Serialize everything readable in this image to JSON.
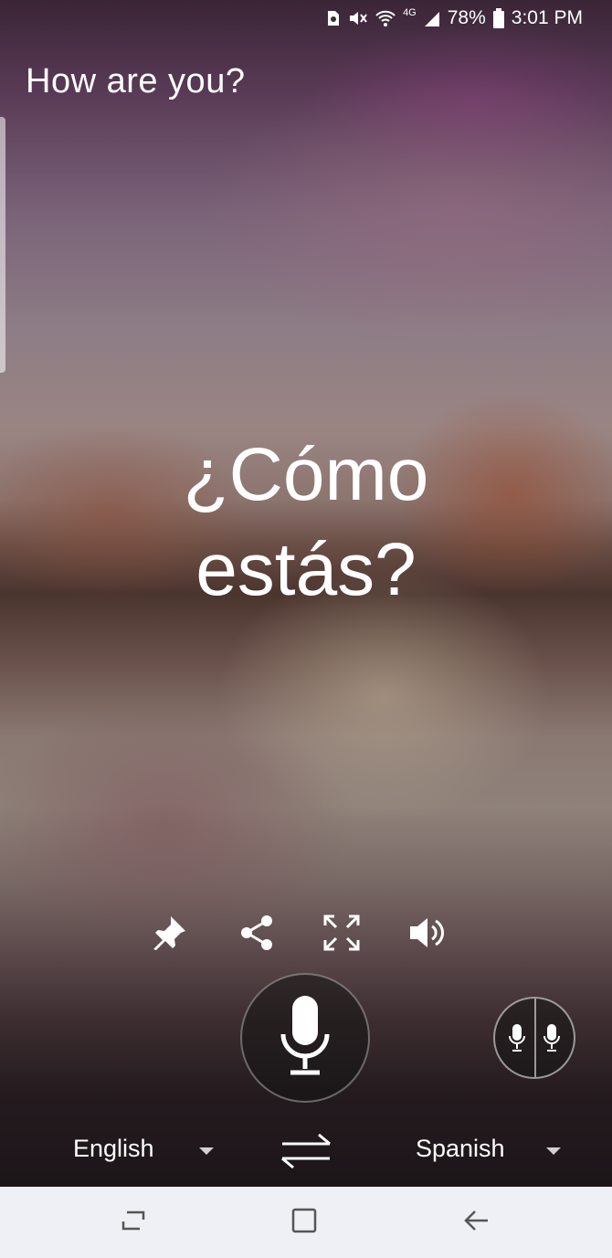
{
  "status_bar": {
    "network": "4G",
    "battery_percent": "78%",
    "time": "3:01 PM"
  },
  "source": {
    "text": "How are you?"
  },
  "translation": {
    "line1": "¿Cómo",
    "line2": "estás?"
  },
  "actions": [
    "pin-icon",
    "share-icon",
    "fullscreen-icon",
    "speaker-icon"
  ],
  "languages": {
    "from": "English",
    "to": "Spanish"
  },
  "navigation": [
    "recents-icon",
    "home-icon",
    "back-icon"
  ],
  "colors": {
    "nav_bar": "#eef0f5",
    "text": "#ffffff"
  }
}
